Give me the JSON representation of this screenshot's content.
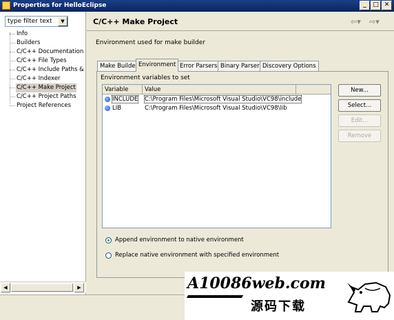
{
  "window": {
    "title": "Properties for HelloEclipse",
    "controls": {
      "minimize": "_",
      "maximize": "□",
      "close": "✕"
    }
  },
  "left": {
    "filter_placeholder": "type filter text",
    "tree": [
      {
        "label": "Info",
        "selected": false
      },
      {
        "label": "Builders",
        "selected": false
      },
      {
        "label": "C/C++ Documentation",
        "selected": false
      },
      {
        "label": "C/C++ File Types",
        "selected": false
      },
      {
        "label": "C/C++ Include Paths & S",
        "selected": false
      },
      {
        "label": "C/C++ Indexer",
        "selected": false
      },
      {
        "label": "C/C++ Make Project",
        "selected": true
      },
      {
        "label": "C/C++ Project Paths",
        "selected": false
      },
      {
        "label": "Project References",
        "selected": false
      }
    ]
  },
  "page": {
    "title": "C/C++ Make Project",
    "description": "Environment used for make builder",
    "nav": {
      "back_icon": "arrow-left-icon",
      "forward_icon": "arrow-right-icon"
    }
  },
  "tabs": [
    {
      "label": "Make Builder",
      "active": false
    },
    {
      "label": "Environment",
      "active": true
    },
    {
      "label": "Error Parsers",
      "active": false
    },
    {
      "label": "Binary Parser",
      "active": false
    },
    {
      "label": "Discovery Options",
      "active": false
    }
  ],
  "environment": {
    "section_label": "Environment variables to set",
    "columns": [
      "Variable",
      "Value"
    ],
    "rows": [
      {
        "variable": "INCLUDE",
        "value": "C:\\Program Files\\Microsoft Visual Studio\\VC98\\include"
      },
      {
        "variable": "LIB",
        "value": "C:\\Program Files\\Microsoft Visual Studio\\VC98\\lib"
      }
    ],
    "buttons": {
      "new": "New...",
      "select": "Select...",
      "edit": "Edit...",
      "remove": "Remove"
    },
    "options": [
      {
        "label": "Append environment to native environment",
        "checked": true
      },
      {
        "label": "Replace native environment with specified environment",
        "checked": false
      }
    ]
  },
  "watermark": {
    "logo": "A10086web.com",
    "subtitle": "源码下载"
  }
}
